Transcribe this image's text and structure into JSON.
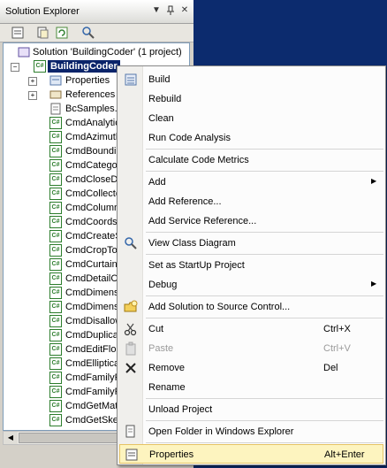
{
  "panel": {
    "title": "Solution Explorer",
    "title_buttons": [
      "▼",
      "📌",
      "✕"
    ]
  },
  "tree": {
    "solution": "Solution 'BuildingCoder' (1 project)",
    "project": "BuildingCoder",
    "items": [
      {
        "label": "Properties",
        "icon": "properties-icon",
        "expand": "+"
      },
      {
        "label": "References",
        "icon": "references-icon",
        "expand": "+"
      },
      {
        "label": "BcSamples.t",
        "icon": "text-file-icon"
      },
      {
        "label": "CmdAnalytic",
        "icon": "cs-file-icon"
      },
      {
        "label": "CmdAzimuth",
        "icon": "cs-file-icon"
      },
      {
        "label": "CmdBoundin",
        "icon": "cs-file-icon"
      },
      {
        "label": "CmdCatego",
        "icon": "cs-file-icon"
      },
      {
        "label": "CmdCloseDo",
        "icon": "cs-file-icon"
      },
      {
        "label": "CmdCollecto",
        "icon": "cs-file-icon"
      },
      {
        "label": "CmdColumn",
        "icon": "cs-file-icon"
      },
      {
        "label": "CmdCoordsS",
        "icon": "cs-file-icon"
      },
      {
        "label": "CmdCreateS",
        "icon": "cs-file-icon"
      },
      {
        "label": "CmdCropTo",
        "icon": "cs-file-icon"
      },
      {
        "label": "CmdCurtain",
        "icon": "cs-file-icon"
      },
      {
        "label": "CmdDetailC",
        "icon": "cs-file-icon"
      },
      {
        "label": "CmdDimensi",
        "icon": "cs-file-icon"
      },
      {
        "label": "CmdDimensi",
        "icon": "cs-file-icon"
      },
      {
        "label": "CmdDisallow",
        "icon": "cs-file-icon"
      },
      {
        "label": "CmdDuplicat",
        "icon": "cs-file-icon"
      },
      {
        "label": "CmdEditFloo",
        "icon": "cs-file-icon"
      },
      {
        "label": "CmdElliptica",
        "icon": "cs-file-icon"
      },
      {
        "label": "CmdFamilyP",
        "icon": "cs-file-icon"
      },
      {
        "label": "CmdFamilyP",
        "icon": "cs-file-icon"
      },
      {
        "label": "CmdGetMat",
        "icon": "cs-file-icon"
      },
      {
        "label": "CmdGetSket",
        "icon": "cs-file-icon"
      }
    ]
  },
  "menu": {
    "items": [
      {
        "label": "Build",
        "icon": "build-icon",
        "name": "menu-build"
      },
      {
        "label": "Rebuild",
        "name": "menu-rebuild"
      },
      {
        "label": "Clean",
        "name": "menu-clean"
      },
      {
        "label": "Run Code Analysis",
        "name": "menu-run-code-analysis"
      },
      {
        "sep": true
      },
      {
        "label": "Calculate Code Metrics",
        "name": "menu-calculate-code-metrics"
      },
      {
        "sep": true
      },
      {
        "label": "Add",
        "submenu": true,
        "name": "menu-add"
      },
      {
        "label": "Add Reference...",
        "name": "menu-add-reference"
      },
      {
        "label": "Add Service Reference...",
        "name": "menu-add-service-reference"
      },
      {
        "sep": true
      },
      {
        "label": "View Class Diagram",
        "icon": "class-diagram-icon",
        "name": "menu-view-class-diagram"
      },
      {
        "sep": true
      },
      {
        "label": "Set as StartUp Project",
        "name": "menu-set-startup-project"
      },
      {
        "label": "Debug",
        "submenu": true,
        "name": "menu-debug"
      },
      {
        "sep": true
      },
      {
        "label": "Add Solution to Source Control...",
        "icon": "source-control-icon",
        "name": "menu-add-solution-source-control"
      },
      {
        "sep": true
      },
      {
        "label": "Cut",
        "shortcut": "Ctrl+X",
        "icon": "scissors-icon",
        "name": "menu-cut"
      },
      {
        "label": "Paste",
        "shortcut": "Ctrl+V",
        "icon": "paste-icon",
        "disabled": true,
        "name": "menu-paste"
      },
      {
        "label": "Remove",
        "shortcut": "Del",
        "icon": "remove-x-icon",
        "name": "menu-remove"
      },
      {
        "label": "Rename",
        "name": "menu-rename"
      },
      {
        "sep": true
      },
      {
        "label": "Unload Project",
        "name": "menu-unload-project"
      },
      {
        "sep": true
      },
      {
        "label": "Open Folder in Windows Explorer",
        "icon": "open-folder-icon",
        "name": "menu-open-folder"
      },
      {
        "sep": true
      },
      {
        "label": "Properties",
        "shortcut": "Alt+Enter",
        "icon": "properties-icon",
        "highlight": true,
        "name": "menu-properties"
      }
    ]
  },
  "colors": {
    "highlight_bg": "#fdf4bf",
    "highlight_border": "#e5c365",
    "selected_node": "#0a246a"
  }
}
